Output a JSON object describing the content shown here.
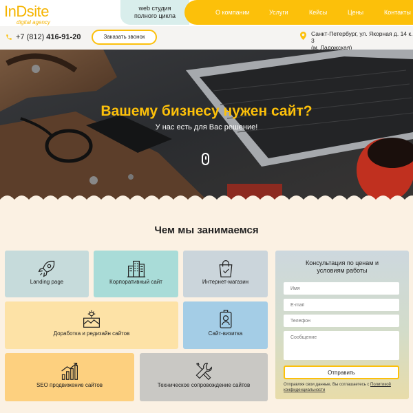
{
  "header": {
    "logo": {
      "text": "InDsite",
      "subtitle": "digital agency"
    },
    "tagline": [
      "web студия",
      "полного цикла"
    ],
    "nav": [
      {
        "label": "О компании"
      },
      {
        "label": "Услуги"
      },
      {
        "label": "Кейсы"
      },
      {
        "label": "Цены"
      },
      {
        "label": "Контакты"
      }
    ],
    "phone": {
      "prefix": "+7 (812)",
      "number": "416-91-20"
    },
    "callback_label": "Заказать звонок",
    "address": [
      "Санкт-Петербург, ул. Якорная д. 14 к. 3",
      "(м. Ладожская)"
    ]
  },
  "hero": {
    "title": "Вашему бизнесу нужен сайт?",
    "subtitle": "У нас есть для Вас решение!"
  },
  "services": {
    "title": "Чем мы занимаемся",
    "items": [
      {
        "label": "Landing page",
        "icon": "rocket-icon"
      },
      {
        "label": "Корпоративный сайт",
        "icon": "buildings-icon"
      },
      {
        "label": "Интернет-магазин",
        "icon": "shopping-bag-icon"
      },
      {
        "label": "Доработка и редизайн сайтов",
        "icon": "redesign-icon"
      },
      {
        "label": "Сайт-визитка",
        "icon": "id-badge-icon"
      },
      {
        "label": "SEO продвижение сайтов",
        "icon": "growth-chart-icon"
      },
      {
        "label": "Техническое сопровождение сайтов",
        "icon": "tools-icon"
      }
    ]
  },
  "form": {
    "title": [
      "Консультация по ценам и",
      "условиям работы"
    ],
    "name_placeholder": "Имя",
    "email_placeholder": "E-mail",
    "phone_placeholder": "Телефон",
    "message_placeholder": "Сообщение",
    "submit_label": "Отправить",
    "consent_text": "Отправляя свои данные, Вы соглашаетесь с ",
    "consent_link": "Политикой конфиденциальности"
  },
  "colors": {
    "accent": "#fcc00a",
    "background": "#fbf1e3"
  }
}
